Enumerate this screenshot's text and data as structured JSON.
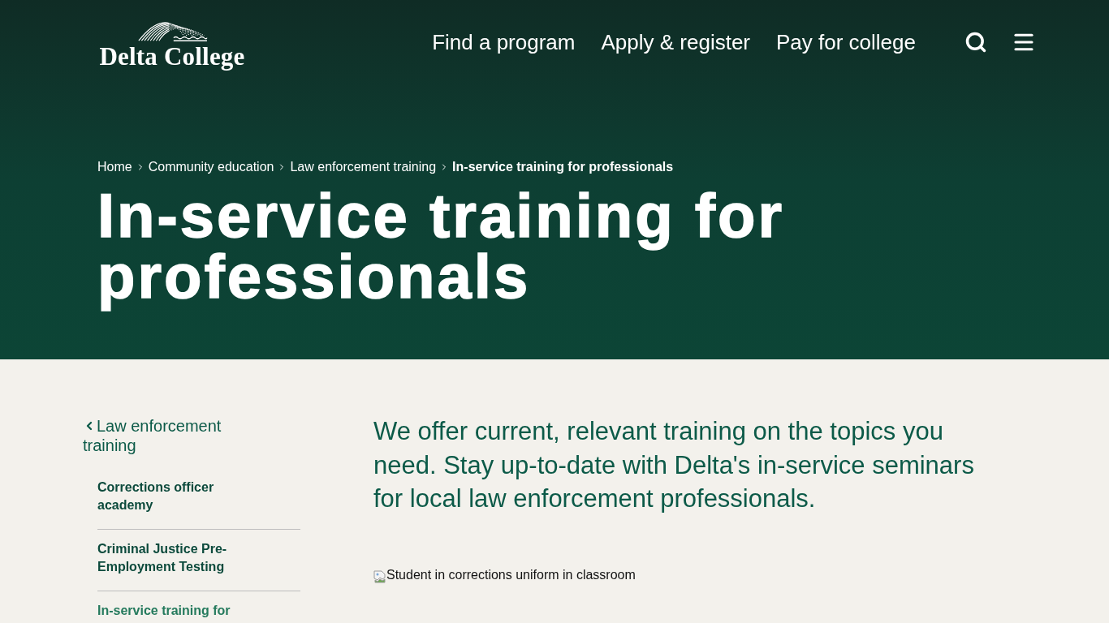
{
  "header": {
    "logo_text": "Delta College",
    "nav": [
      "Find a program",
      "Apply & register",
      "Pay for college"
    ]
  },
  "hero": {
    "breadcrumb": [
      {
        "label": "Home",
        "current": false
      },
      {
        "label": "Community education",
        "current": false
      },
      {
        "label": "Law enforcement training",
        "current": false
      },
      {
        "label": "In-service training for professionals",
        "current": true
      }
    ],
    "title": "In-service training for professionals"
  },
  "sidebar": {
    "back_link": "Law enforcement training",
    "items": [
      {
        "label": "Corrections officer academy",
        "selected": false
      },
      {
        "label": "Criminal Justice Pre-Employment Testing",
        "selected": false
      },
      {
        "label": "In-service training for",
        "selected": true
      }
    ]
  },
  "content": {
    "intro": "We offer current, relevant training on the topics you need. Stay up-to-date with Delta's in-service seminars for local law enforcement professionals.",
    "image_alt": "Student in corrections uniform in classroom"
  }
}
